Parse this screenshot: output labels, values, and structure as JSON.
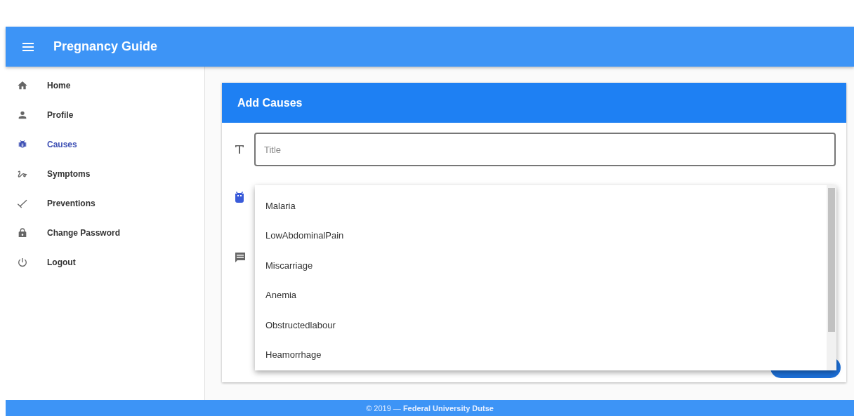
{
  "app_bar": {
    "title": "Pregnancy Guide"
  },
  "sidebar": {
    "items": [
      {
        "label": "Home",
        "kind": "home",
        "selected": false
      },
      {
        "label": "Profile",
        "kind": "person",
        "selected": false
      },
      {
        "label": "Causes",
        "kind": "bug",
        "selected": true
      },
      {
        "label": "Symptoms",
        "kind": "squiggle",
        "selected": false
      },
      {
        "label": "Preventions",
        "kind": "check",
        "selected": false
      },
      {
        "label": "Change Password",
        "kind": "lock",
        "selected": false
      },
      {
        "label": "Logout",
        "kind": "power",
        "selected": false
      }
    ]
  },
  "card": {
    "title": "Add Causes",
    "title_field": {
      "placeholder": "Title"
    },
    "dropdown": {
      "options": [
        "Malaria",
        "LowAbdominalPain",
        "Miscarriage",
        "Anemia",
        "Obstructedlabour",
        "Heamorrhage"
      ]
    }
  },
  "footer": "© 2019 — **Federal University Dutse**"
}
